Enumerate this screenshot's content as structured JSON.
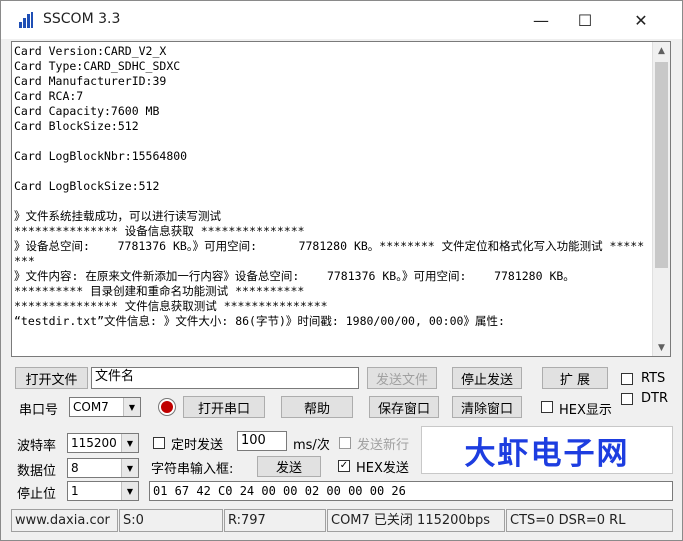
{
  "window": {
    "title": "SSCOM 3.3",
    "minimize_glyph": "—",
    "maximize_glyph": "☐",
    "close_glyph": "✕"
  },
  "log": {
    "text": "Card Version:CARD_V2_X\nCard Type:CARD_SDHC_SDXC\nCard ManufacturerID:39\nCard RCA:7\nCard Capacity:7600 MB\nCard BlockSize:512\n\nCard LogBlockNbr:15564800\n\nCard LogBlockSize:512\n\n》文件系统挂载成功，可以进行读写测试\n*************** 设备信息获取 ***************\n》设备总空间:    7781376 KB。》可用空间:      7781280 KB。******** 文件定位和格式化写入功能测试 ********\n》文件内容: 在原来文件新添加一行内容》设备总空间:    7781376 KB。》可用空间:    7781280 KB。\n********** 目录创建和重命名功能测试 **********\n*************** 文件信息获取测试 ***************\n“testdir.txt”文件信息: 》文件大小: 86(字节)》时间戳: 1980/00/00, 00:00》属性:"
  },
  "row1": {
    "open_file": "打开文件",
    "filename": "文件名",
    "send_file": "发送文件",
    "stop_send": "停止发送",
    "extend": "扩 展",
    "rts": "RTS"
  },
  "row2": {
    "port_label": "串口号",
    "port_value": "COM7",
    "open_port": "打开串口",
    "help": "帮助",
    "save_window": "保存窗口",
    "clear_window": "清除窗口",
    "hex_display": "HEX显示",
    "dtr": "DTR"
  },
  "settings": {
    "baud_label": "波特率",
    "baud_value": "115200",
    "databits_label": "数据位",
    "databits_value": "8",
    "stopbits_label": "停止位",
    "stopbits_value": "1",
    "timed_send": "定时发送",
    "interval": "100",
    "interval_unit": "ms/次",
    "send_newline": "发送新行",
    "string_input_label": "字符串输入框:",
    "send": "发送",
    "hex_send": "HEX发送",
    "send_data": "01 67 42 C0 24 00 00 02 00 00 00 26"
  },
  "brand": "大虾电子网",
  "statusbar": {
    "website": "www.daxia.cor",
    "sent": "S:0",
    "received": "R:797",
    "port_status": "COM7 已关闭  115200bps",
    "signals": "CTS=0 DSR=0 RL"
  },
  "colors": {
    "brand": "#1d3de0",
    "radio_dot": "#c00000"
  },
  "icons": [
    "app-icon",
    "record-icon"
  ]
}
